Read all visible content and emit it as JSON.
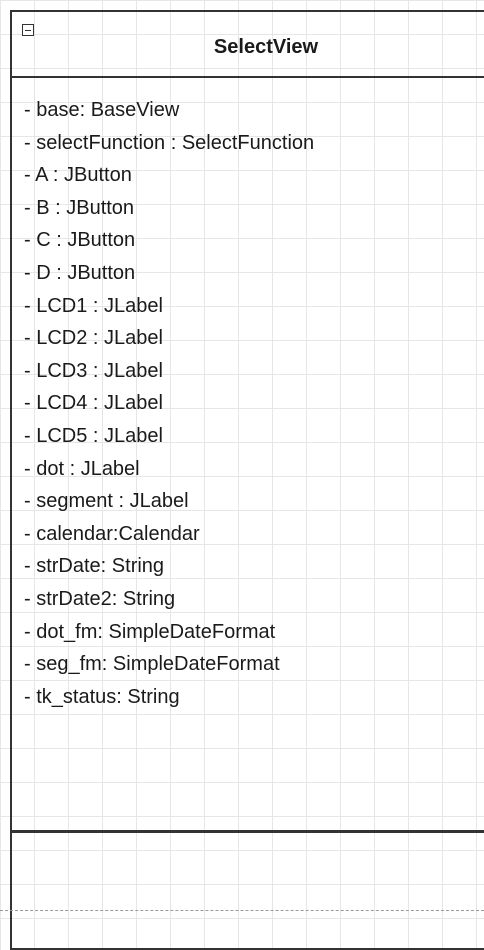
{
  "diagram": {
    "class": {
      "name": "SelectView",
      "collapse_icon": "minus-square-icon",
      "attributes": [
        "- base: BaseView",
        "- selectFunction : SelectFunction",
        "- A : JButton",
        "- B : JButton",
        "- C : JButton",
        "- D : JButton",
        "- LCD1 : JLabel",
        "- LCD2 : JLabel",
        "- LCD3 : JLabel",
        "- LCD4 : JLabel",
        "- LCD5 : JLabel",
        "- dot : JLabel",
        "- segment : JLabel",
        "- calendar:Calendar",
        "- strDate: String",
        "- strDate2: String",
        "- dot_fm: SimpleDateFormat",
        "- seg_fm: SimpleDateFormat",
        "- tk_status: String"
      ],
      "methods": []
    },
    "colors": {
      "border": "#333333",
      "text": "#1a1a1a",
      "grid": "#e6e6e6",
      "background": "#ffffff"
    }
  }
}
